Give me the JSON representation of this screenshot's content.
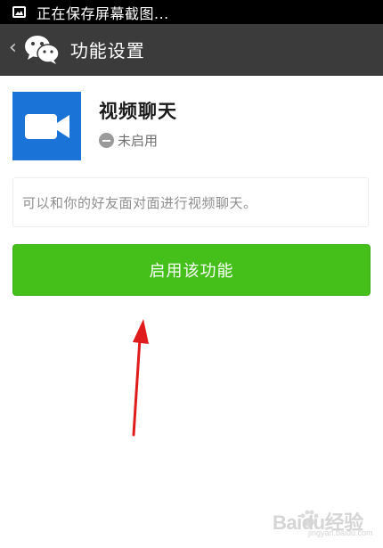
{
  "status_bar": {
    "text": "正在保存屏幕截图..."
  },
  "title_bar": {
    "title": "功能设置",
    "back_icon": "chevron-left-icon",
    "logo_icon": "wechat-logo-icon"
  },
  "feature": {
    "name": "视频聊天",
    "status": "未启用",
    "icon": "video-camera-icon",
    "icon_color": "#1a73d6"
  },
  "description": {
    "text": "可以和你的好友面对面进行视频聊天。"
  },
  "action": {
    "button_label": "启用该功能",
    "button_color": "#45c01a"
  },
  "watermark": {
    "text": "Baidu经验",
    "url": "jingyan.baidu.com"
  },
  "colors": {
    "status_bar_bg": "#000000",
    "title_bar_bg": "#3b3b3b",
    "arrow": "#e01b1b"
  }
}
